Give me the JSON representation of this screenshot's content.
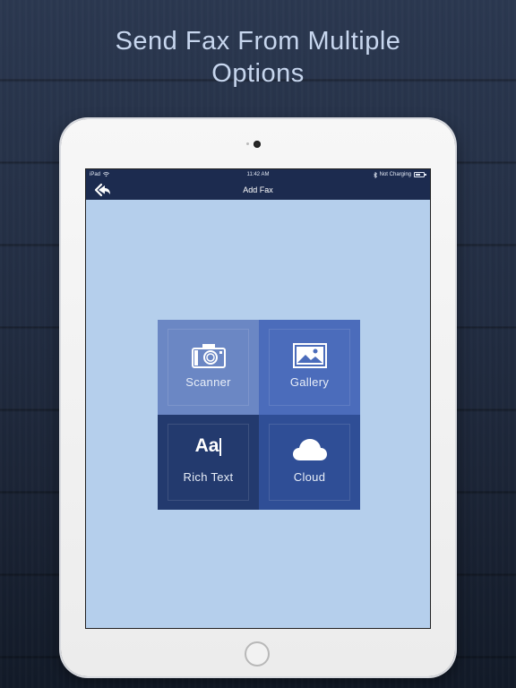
{
  "headline": {
    "line1": "Send Fax From Multiple",
    "line2": "Options"
  },
  "status_bar": {
    "device": "iPad",
    "time": "11:42 AM",
    "charging": "Not Charging",
    "battery_level": 0.6
  },
  "nav": {
    "title": "Add Fax",
    "back_icon": "double-chevron-left-icon"
  },
  "options": [
    {
      "label": "Scanner",
      "icon": "camera-icon"
    },
    {
      "label": "Gallery",
      "icon": "image-icon"
    },
    {
      "label": "Rich Text",
      "icon": "text-format-icon",
      "glyph": "Aa"
    },
    {
      "label": "Cloud",
      "icon": "cloud-icon"
    }
  ],
  "colors": {
    "screen_bg": "#b5cfec",
    "nav_bg": "#1c2b4f",
    "scanner_tile": "#6b87c4",
    "gallery_tile": "#4b6cbb",
    "richtext_tile": "#233a6e",
    "cloud_tile": "#2f4e96"
  }
}
